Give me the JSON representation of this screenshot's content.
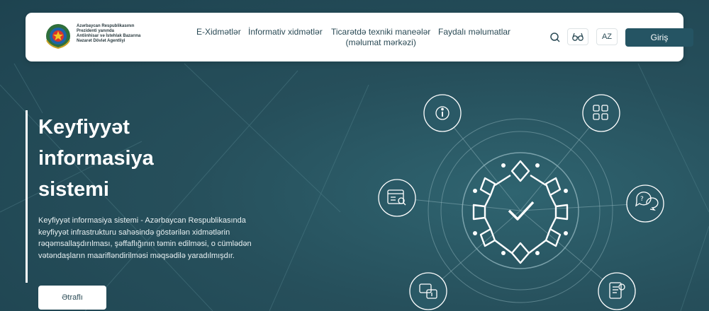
{
  "header": {
    "logo_text": [
      "Azərbaycan Respublikasının",
      "Prezidenti yanında",
      "Antiinhisar və İstehlak Bazarına",
      "Nəzarət Dövlət Agentliyi"
    ],
    "nav": [
      {
        "label": "E-Xidmətlər",
        "sub": ""
      },
      {
        "label": "İnformativ xidmətlər",
        "sub": ""
      },
      {
        "label": "Ticarətdə texniki maneələr",
        "sub": "(məlumat mərkəzi)"
      },
      {
        "label": "Faydalı məlumatlar",
        "sub": ""
      }
    ],
    "lang": "AZ",
    "login": "Giriş"
  },
  "hero": {
    "title_lines": [
      "Keyfiyyət",
      "informasiya",
      "sistemi"
    ],
    "description": "Keyfiyyət informasiya sistemi - Azərbaycan Respublikasında keyfiyyət infrastrukturu sahəsində göstərilən xidmətlərin rəqəmsallaşdırılması, şəffaflığının təmin edilməsi, o cümlədən vətəndaşların maarifləndirilməsi məqsədilə yaradılmışdır.",
    "more": "Ətraflı"
  },
  "colors": {
    "background": "#264f5b",
    "primary": "#255463",
    "text_dark": "#2a4a55"
  },
  "icons": [
    "search-icon",
    "eye-glasses-icon",
    "info-icon",
    "grid-icon",
    "question-chat-icon",
    "search-document-icon",
    "chat-info-icon",
    "document-info-icon",
    "quality-check-icon"
  ]
}
